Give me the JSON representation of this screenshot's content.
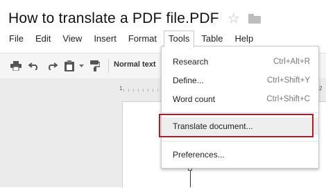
{
  "document": {
    "title": "How to translate a PDF file.PDF",
    "star_icon": "star-outline-icon",
    "folder_icon": "folder-icon"
  },
  "menubar": {
    "items": [
      {
        "label": "File"
      },
      {
        "label": "Edit"
      },
      {
        "label": "View"
      },
      {
        "label": "Insert"
      },
      {
        "label": "Format"
      },
      {
        "label": "Tools",
        "active": true
      },
      {
        "label": "Table"
      },
      {
        "label": "Help"
      }
    ]
  },
  "toolbar": {
    "icons": [
      "print-icon",
      "undo-icon",
      "redo-icon",
      "paste-icon",
      "dropdown-arrow-icon",
      "paint-format-icon"
    ],
    "style_value": "Normal text"
  },
  "ruler": {
    "left_number": "1",
    "right_number": "2"
  },
  "tools_menu": {
    "items": [
      {
        "label": "Research",
        "shortcut": "Ctrl+Alt+R"
      },
      {
        "label": "Define...",
        "shortcut": "Ctrl+Shift+Y"
      },
      {
        "label": "Word count",
        "shortcut": "Ctrl+Shift+C"
      },
      {
        "label": "Translate document...",
        "shortcut": "",
        "highlighted": true
      },
      {
        "label": "Preferences...",
        "shortcut": ""
      }
    ]
  },
  "colors": {
    "highlight_border": "#b01d24",
    "toolbar_bg": "#f5f5f5",
    "workspace_bg": "#ebebeb"
  }
}
